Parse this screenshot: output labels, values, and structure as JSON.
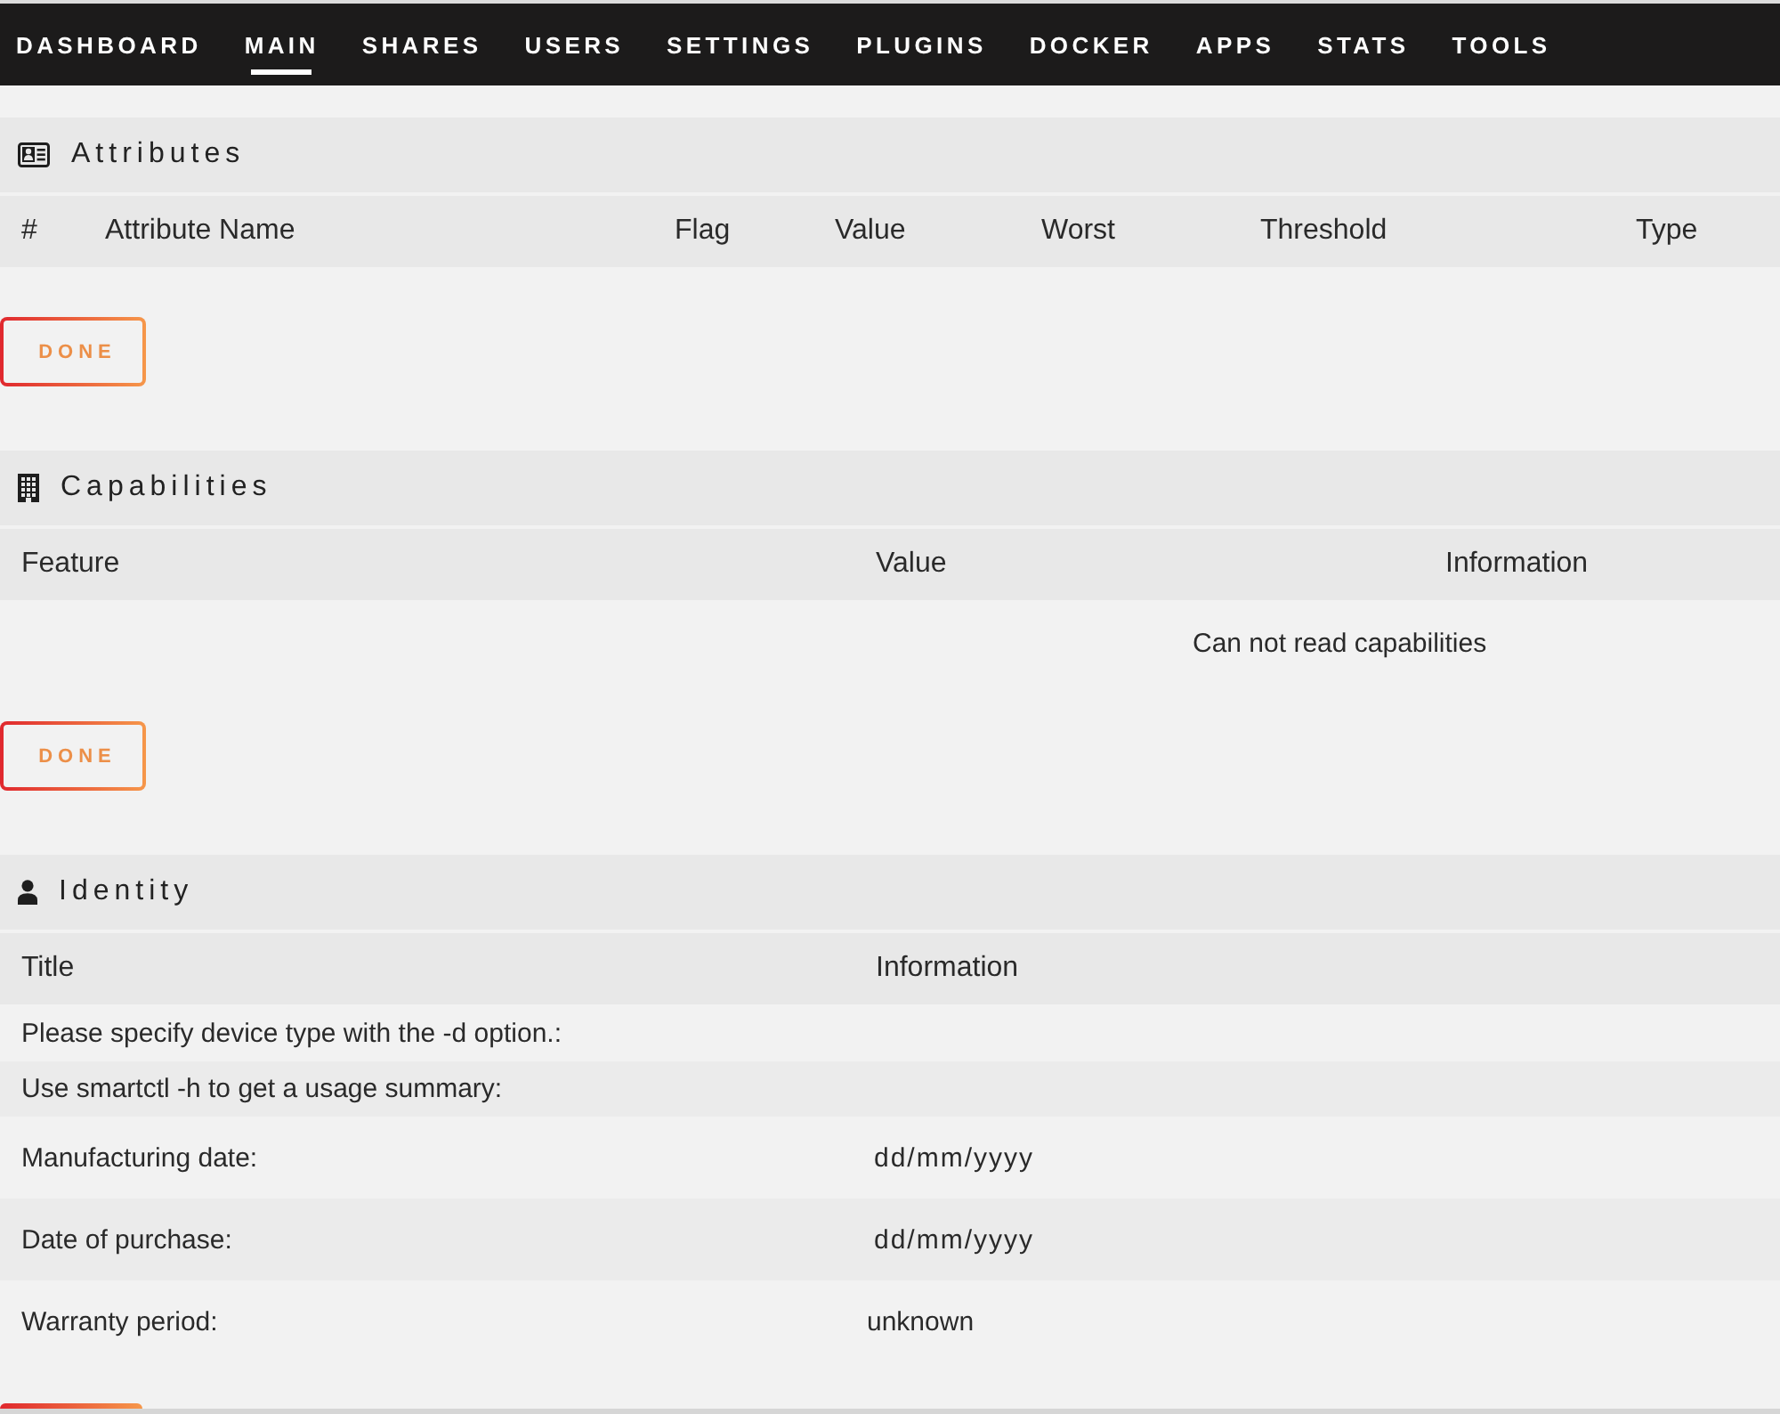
{
  "nav": {
    "items": [
      {
        "label": "DASHBOARD",
        "selected": false
      },
      {
        "label": "MAIN",
        "selected": true
      },
      {
        "label": "SHARES",
        "selected": false
      },
      {
        "label": "USERS",
        "selected": false
      },
      {
        "label": "SETTINGS",
        "selected": false
      },
      {
        "label": "PLUGINS",
        "selected": false
      },
      {
        "label": "DOCKER",
        "selected": false
      },
      {
        "label": "APPS",
        "selected": false
      },
      {
        "label": "STATS",
        "selected": false
      },
      {
        "label": "TOOLS",
        "selected": false
      }
    ]
  },
  "sections": [
    {
      "title": "Attributes",
      "columns": [
        "#",
        "Attribute Name",
        "Flag",
        "Value",
        "Worst",
        "Threshold",
        "Type"
      ],
      "button": "DONE"
    },
    {
      "title": "Capabilities",
      "columns": [
        "Feature",
        "Value",
        "Information"
      ],
      "message": "Can not read capabilities",
      "button": "DONE"
    },
    {
      "title": "Identity",
      "columns": [
        "Title",
        "Information"
      ],
      "rows": [
        {
          "kind": "text",
          "title": "Please specify device type with the -d option.:"
        },
        {
          "kind": "text",
          "title": "Use smartctl -h to get a usage summary:"
        },
        {
          "kind": "date",
          "title": "Manufacturing date:",
          "value": "dd/mm/yyyy"
        },
        {
          "kind": "date",
          "title": "Date of purchase:",
          "value": "dd/mm/yyyy"
        },
        {
          "kind": "select",
          "title": "Warranty period:",
          "value": "unknown"
        }
      ]
    }
  ]
}
